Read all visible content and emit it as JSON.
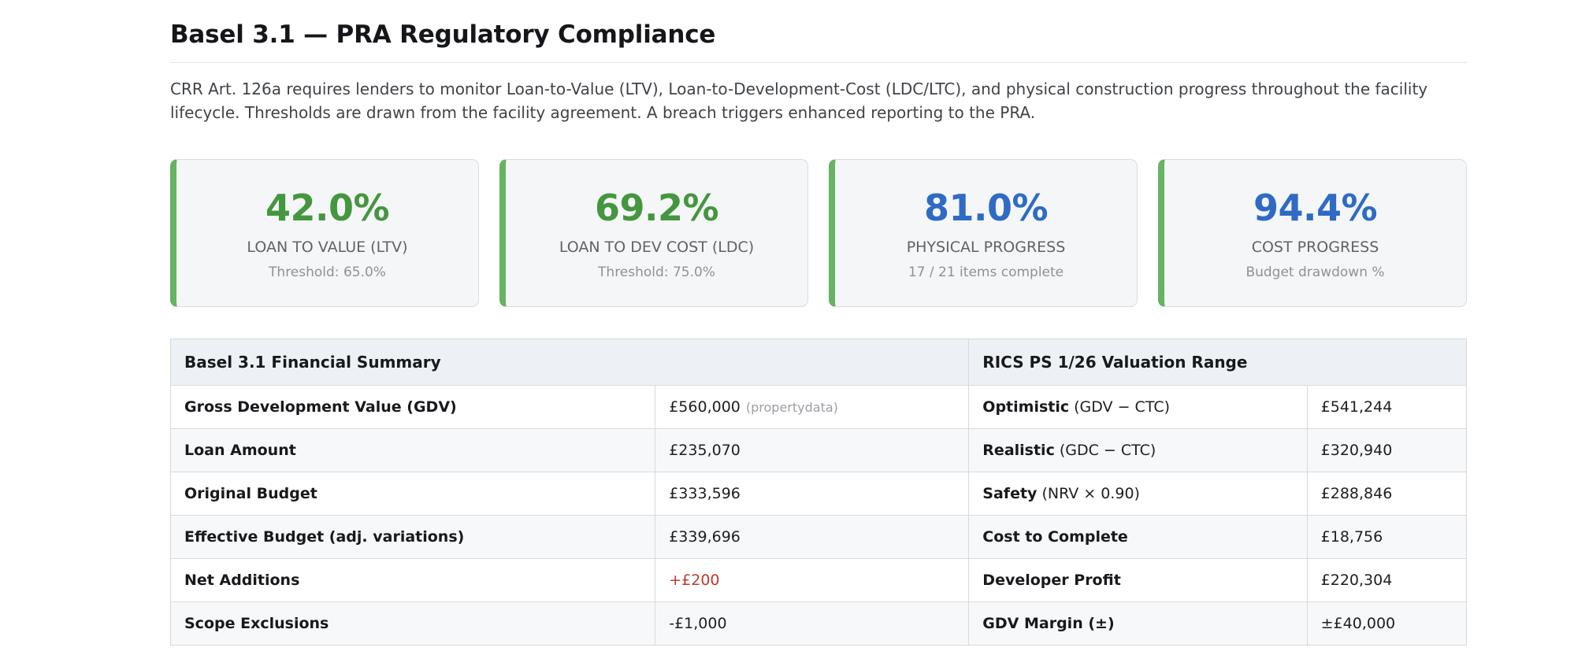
{
  "page": {
    "title": "Basel 3.1 — PRA Regulatory Compliance",
    "intro": "CRR Art. 126a requires lenders to monitor Loan-to-Value (LTV), Loan-to-Development-Cost (LDC/LTC), and physical construction progress throughout the facility lifecycle. Thresholds are drawn from the facility agreement. A breach triggers enhanced reporting to the PRA."
  },
  "colors": {
    "green": "#44963f",
    "blue": "#2f6bc4",
    "red": "#c0392b",
    "card_accent": "#66b361"
  },
  "kpi_cards": [
    {
      "value": "42.0%",
      "value_color": "green",
      "label": "LOAN TO VALUE (LTV)",
      "sub": "Threshold: 65.0%"
    },
    {
      "value": "69.2%",
      "value_color": "green",
      "label": "LOAN TO DEV COST (LDC)",
      "sub": "Threshold: 75.0%"
    },
    {
      "value": "81.0%",
      "value_color": "blue",
      "label": "PHYSICAL PROGRESS",
      "sub": "17 / 21 items complete"
    },
    {
      "value": "94.4%",
      "value_color": "blue",
      "label": "COST PROGRESS",
      "sub": "Budget drawdown %"
    }
  ],
  "table": {
    "headers": [
      "Basel 3.1 Financial Summary",
      "RICS PS 1/26 Valuation Range"
    ],
    "rows": [
      {
        "label": "Gross Development Value (GDV)",
        "value": "£560,000",
        "value_note": "(propertydata)",
        "value_color": "",
        "r_label_bold": "Optimistic",
        "r_label_normal": "(GDV − CTC)",
        "r_value": "£541,244"
      },
      {
        "label": "Loan Amount",
        "value": "£235,070",
        "value_note": "",
        "value_color": "",
        "r_label_bold": "Realistic",
        "r_label_normal": "(GDC − CTC)",
        "r_value": "£320,940"
      },
      {
        "label": "Original Budget",
        "value": "£333,596",
        "value_note": "",
        "value_color": "",
        "r_label_bold": "Safety",
        "r_label_normal": "(NRV × 0.90)",
        "r_value": "£288,846"
      },
      {
        "label": "Effective Budget (adj. variations)",
        "value": "£339,696",
        "value_note": "",
        "value_color": "",
        "r_label_bold": "Cost to Complete",
        "r_label_normal": "",
        "r_value": "£18,756"
      },
      {
        "label": "Net Additions",
        "value": "+£200",
        "value_note": "",
        "value_color": "red",
        "r_label_bold": "Developer Profit",
        "r_label_normal": "",
        "r_value": "£220,304"
      },
      {
        "label": "Scope Exclusions",
        "value": "-£1,000",
        "value_note": "",
        "value_color": "",
        "r_label_bold": "GDV Margin (±)",
        "r_label_normal": "",
        "r_value": "±£40,000"
      }
    ]
  }
}
